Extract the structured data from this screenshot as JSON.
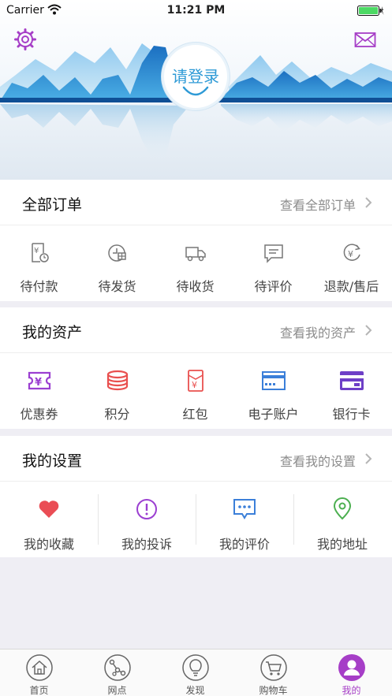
{
  "status_bar": {
    "carrier": "Carrier",
    "time": "11:21 PM"
  },
  "header": {
    "login_label": "请登录",
    "settings_icon": "gear-icon",
    "messages_icon": "mail-icon"
  },
  "orders": {
    "title": "全部订单",
    "link": "查看全部订单",
    "items": [
      {
        "label": "待付款",
        "icon": "pending-payment-icon"
      },
      {
        "label": "待发货",
        "icon": "pending-shipment-icon"
      },
      {
        "label": "待收货",
        "icon": "truck-icon"
      },
      {
        "label": "待评价",
        "icon": "comment-icon"
      },
      {
        "label": "退款/售后",
        "icon": "refund-icon"
      }
    ]
  },
  "assets": {
    "title": "我的资产",
    "link": "查看我的资产",
    "items": [
      {
        "label": "优惠券",
        "icon": "coupon-icon"
      },
      {
        "label": "积分",
        "icon": "points-icon"
      },
      {
        "label": "红包",
        "icon": "red-packet-icon"
      },
      {
        "label": "电子账户",
        "icon": "e-account-icon"
      },
      {
        "label": "银行卡",
        "icon": "bank-card-icon"
      }
    ]
  },
  "settings": {
    "title": "我的设置",
    "link": "查看我的设置",
    "items": [
      {
        "label": "我的收藏",
        "icon": "heart-icon"
      },
      {
        "label": "我的投诉",
        "icon": "alert-icon"
      },
      {
        "label": "我的评价",
        "icon": "chat-icon"
      },
      {
        "label": "我的地址",
        "icon": "location-icon"
      }
    ]
  },
  "tabbar": {
    "active": "我的",
    "tabs": [
      {
        "label": "首页",
        "icon": "home-icon"
      },
      {
        "label": "网点",
        "icon": "network-icon"
      },
      {
        "label": "发现",
        "icon": "bulb-icon"
      },
      {
        "label": "购物车",
        "icon": "cart-icon"
      },
      {
        "label": "我的",
        "icon": "user-icon"
      }
    ]
  },
  "colors": {
    "accent": "#a63ec7",
    "login_blue": "#2e9ad6",
    "icon_gray": "#777777"
  }
}
